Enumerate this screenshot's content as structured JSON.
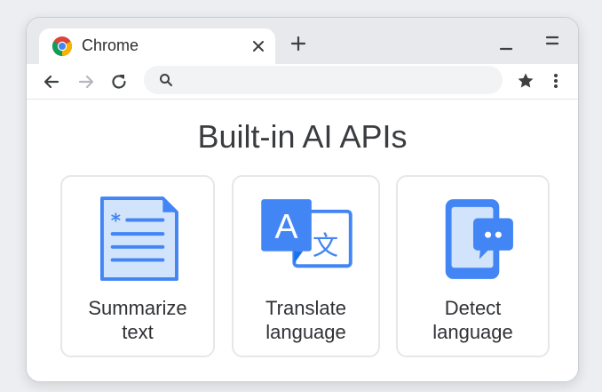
{
  "tab": {
    "title": "Chrome"
  },
  "omnibox": {
    "value": "",
    "placeholder": ""
  },
  "page": {
    "title": "Built-in AI APIs"
  },
  "cards": [
    {
      "line1": "Summarize",
      "line2": "text",
      "icon": "document-icon"
    },
    {
      "line1": "Translate",
      "line2": "language",
      "icon": "translate-icon"
    },
    {
      "line1": "Detect",
      "line2": "language",
      "icon": "phone-chat-icon"
    }
  ],
  "translate_icon": {
    "letter_a": "A",
    "letter_wen": "文"
  },
  "colors": {
    "accent_blue": "#4285f4",
    "dark_blue": "#1a73e8",
    "light_blue": "#d2e3fc",
    "text_dark": "#3a3c40",
    "frame": "#e7e9ec"
  }
}
